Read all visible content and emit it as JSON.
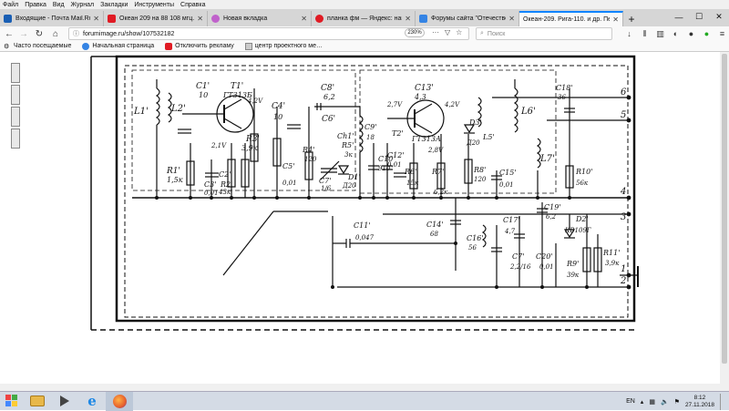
{
  "menu": [
    "Файл",
    "Правка",
    "Вид",
    "Журнал",
    "Закладки",
    "Инструменты",
    "Справка"
  ],
  "tabs": [
    {
      "label": "Входящие - Почта Mail.Ru",
      "color": "#1a5fb4",
      "active": false
    },
    {
      "label": "Океан 209 на 88 108 мгц. Без …",
      "color": "#e01b24",
      "active": false
    },
    {
      "label": "Новая вкладка",
      "color": "#c061cb",
      "active": false
    },
    {
      "label": "планка фм — Яндекс: нашло…",
      "color": "#e01b24",
      "active": false
    },
    {
      "label": "Форумы сайта \"Отечественн…",
      "color": "#3584e4",
      "active": false
    },
    {
      "label": "Океан-209. Рига-110. и др. Перес…",
      "color": "#9a9996",
      "active": true
    }
  ],
  "navbar": {
    "url": "forumimage.ru/show/107532182",
    "zoom": "230%",
    "search_placeholder": "Поиск"
  },
  "bookmarks": [
    {
      "label": "Часто посещаемые",
      "icon": "gear-icon"
    },
    {
      "label": "Начальная страница",
      "icon": "page-icon"
    },
    {
      "label": "Отключить рекламу",
      "icon": "shield-icon"
    },
    {
      "label": "центр проектного ме…",
      "icon": "page-icon"
    }
  ],
  "schematic": {
    "labels": {
      "l1": "L1'",
      "l2": "L2'",
      "c1": "C1'",
      "c1v": "10",
      "t1": "T1'",
      "t1t": "ГТ313Б",
      "v42": "4,2V",
      "v21": "2,1V",
      "r3": "R3'",
      "r3v": "3,9к",
      "c4": "C4'",
      "c4v": "10",
      "c8": "C8'",
      "c8v": "6,2",
      "c6": "C6'",
      "c3": "C3'",
      "c3v": "0,01",
      "c2": "C2'",
      "c2v": "43",
      "r1": "R1'",
      "r1v": "1,5к",
      "r2": "R2'",
      "r2v": "43к",
      "c5": "C5'",
      "c5v": "0,01",
      "r4": "R4'",
      "r4v": "120",
      "c7": "C7'",
      "c7v": "1/6",
      "ch1": "Сh1'",
      "r5": "R5'",
      "r5v": "3к",
      "d1": "D1'",
      "d1t": "Д20",
      "c9": "C9'",
      "c9v": "18",
      "c10": "C10",
      "c10v": "910",
      "c13": "C13'",
      "c13v": "4,3",
      "v27": "2,7V",
      "t2": "T2'",
      "t2t": "ГТ313А",
      "c12": "C12'",
      "c12v": "0,01",
      "r6": "R6'",
      "r6v": "15к",
      "r7": "R7'",
      "r7v": "6,2к",
      "v28": "2,8V",
      "v42b": "4,2V",
      "d3": "D3'",
      "d3t": "Д20",
      "l5": "L5'",
      "l6": "L6'",
      "l7": "L7'",
      "r8": "R8'",
      "r8v": "120",
      "c15": "C15'",
      "c15v": "0,01",
      "c18": "C18'",
      "c18v": "36",
      "r10": "R10'",
      "r10v": "56к",
      "c11": "C11'",
      "c11v": "0,047",
      "c14": "C14'",
      "c14v": "68",
      "c16": "C16'",
      "c16v": "56",
      "c17": "C17'",
      "c17v": "4,7",
      "c19": "C19'",
      "c19v": "6,2",
      "d2": "D2'",
      "d2t": "КВ109Г",
      "c7b": "C7'",
      "c7bv": "2,2/16",
      "c20": "C20'",
      "c20v": "0,01",
      "r9": "R9'",
      "r9v": "39к",
      "r11": "R11'",
      "r11v": "3,9к"
    },
    "pins": [
      "6",
      "5",
      "4",
      "3",
      "1",
      "2"
    ]
  },
  "taskbar": {
    "lang": "EN",
    "time": "8:12",
    "date": "27.11.2018"
  }
}
